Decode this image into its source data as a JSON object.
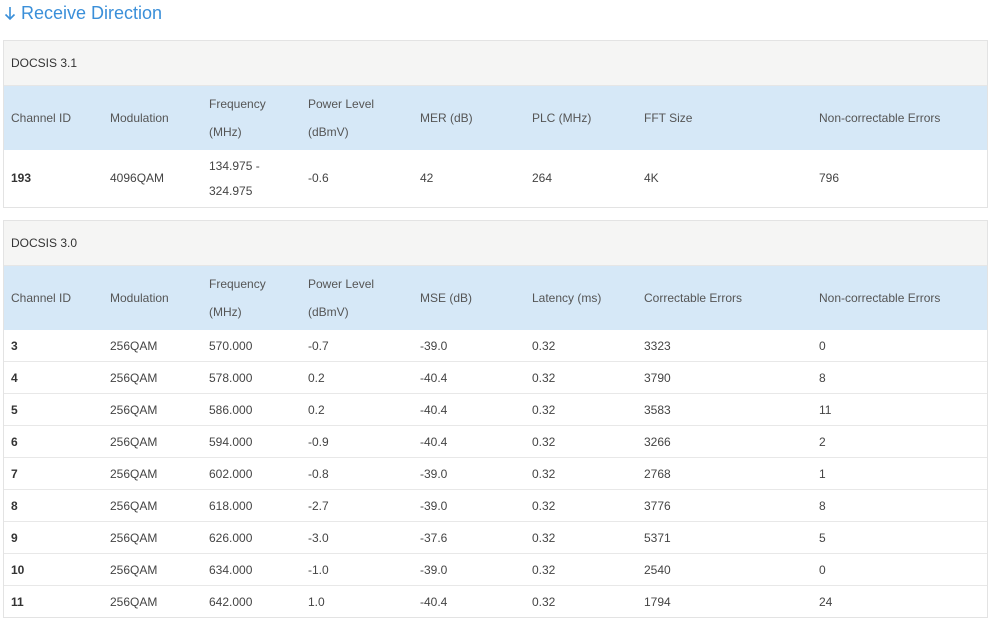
{
  "section": {
    "title": "Receive Direction",
    "arrow_icon": "arrow-down-icon",
    "accent_color": "#3a8fd9"
  },
  "docsis31": {
    "title": "DOCSIS 3.1",
    "headers": [
      "Channel ID",
      "Modulation",
      "Frequency (MHz)",
      "Power Level (dBmV)",
      "MER (dB)",
      "PLC (MHz)",
      "FFT Size",
      "Non-correctable Errors"
    ],
    "rows": [
      [
        "193",
        "4096QAM",
        "134.975 - 324.975",
        "-0.6",
        "42",
        "264",
        "4K",
        "796"
      ]
    ]
  },
  "docsis30": {
    "title": "DOCSIS 3.0",
    "headers": [
      "Channel ID",
      "Modulation",
      "Frequency (MHz)",
      "Power Level (dBmV)",
      "MSE (dB)",
      "Latency (ms)",
      "Correctable Errors",
      "Non-correctable Errors"
    ],
    "rows": [
      [
        "3",
        "256QAM",
        "570.000",
        "-0.7",
        "-39.0",
        "0.32",
        "3323",
        "0"
      ],
      [
        "4",
        "256QAM",
        "578.000",
        "0.2",
        "-40.4",
        "0.32",
        "3790",
        "8"
      ],
      [
        "5",
        "256QAM",
        "586.000",
        "0.2",
        "-40.4",
        "0.32",
        "3583",
        "11"
      ],
      [
        "6",
        "256QAM",
        "594.000",
        "-0.9",
        "-40.4",
        "0.32",
        "3266",
        "2"
      ],
      [
        "7",
        "256QAM",
        "602.000",
        "-0.8",
        "-39.0",
        "0.32",
        "2768",
        "1"
      ],
      [
        "8",
        "256QAM",
        "618.000",
        "-2.7",
        "-39.0",
        "0.32",
        "3776",
        "8"
      ],
      [
        "9",
        "256QAM",
        "626.000",
        "-3.0",
        "-37.6",
        "0.32",
        "5371",
        "5"
      ],
      [
        "10",
        "256QAM",
        "634.000",
        "-1.0",
        "-39.0",
        "0.32",
        "2540",
        "0"
      ],
      [
        "11",
        "256QAM",
        "642.000",
        "1.0",
        "-40.4",
        "0.32",
        "1794",
        "24"
      ]
    ]
  }
}
